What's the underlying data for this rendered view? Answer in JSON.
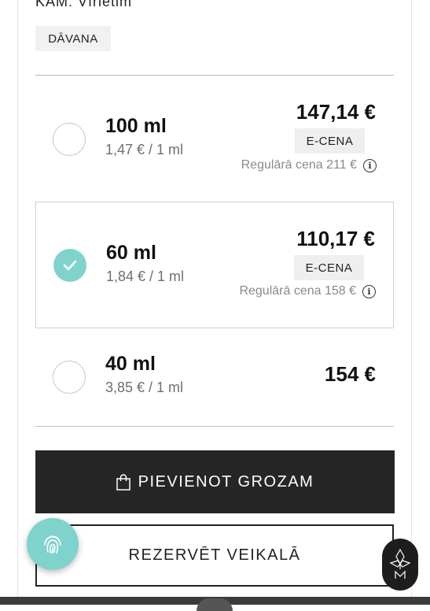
{
  "header": {
    "for_label": "KAM: Vīrietim",
    "gift_tag": "DĀVANA"
  },
  "options": [
    {
      "size": "100 ml",
      "unit_price": "1,47 € / 1 ml",
      "price": "147,14 €",
      "badge": "E-CENA",
      "regular_price": "Regulārā cena 211 €",
      "selected": false
    },
    {
      "size": "60 ml",
      "unit_price": "1,84 € / 1 ml",
      "price": "110,17 €",
      "badge": "E-CENA",
      "regular_price": "Regulārā cena 158 €",
      "selected": true
    },
    {
      "size": "40 ml",
      "unit_price": "3,85 € / 1 ml",
      "price": "154 €",
      "selected": false
    }
  ],
  "actions": {
    "add_to_cart": "PIEVIENOT GROZAM",
    "reserve": "REZERVĒT VEIKALĀ"
  },
  "icons": {
    "info": "i",
    "cart": "shopping-bag-icon",
    "fingerprint": "fingerprint-icon",
    "brand": "brand-logo-icon",
    "check": "checkmark-icon"
  },
  "colors": {
    "accent": "#7fd3cc",
    "primary_button": "#262626",
    "muted_text": "#6f6f6f"
  }
}
